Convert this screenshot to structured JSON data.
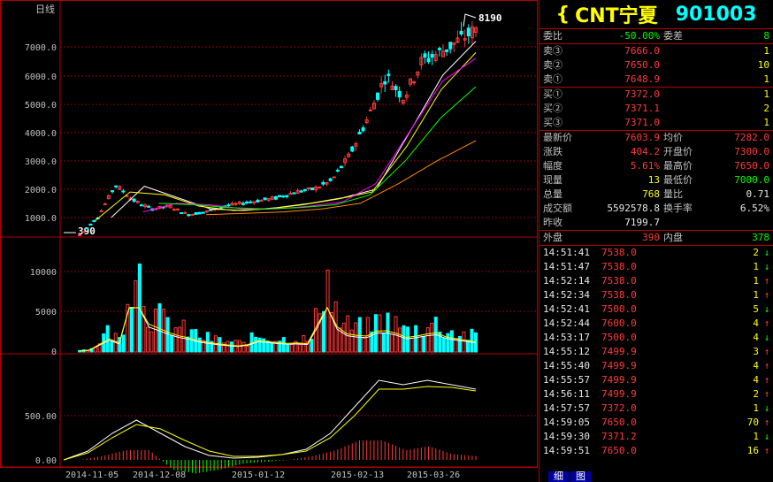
{
  "chart_panel": {
    "period_label": "日线",
    "price_axis_ticks": [
      "7000.0",
      "6000.0",
      "5000.0",
      "4000.0",
      "3000.0",
      "2000.0",
      "1000.0"
    ],
    "volume_axis_ticks": [
      "10000",
      "5000",
      "0"
    ],
    "macd_axis_ticks": [
      "500.00",
      "0.00"
    ],
    "date_labels": [
      "2014-11-05",
      "2014-12-08",
      "2015-01-12",
      "2015-02-13",
      "2015-03-26"
    ],
    "low_marker": "390",
    "high_marker": "8190"
  },
  "chart_data": [
    {
      "type": "candlestick",
      "title": "日线",
      "x": [
        "2014-11-05",
        "2014-12-08",
        "2015-01-12",
        "2015-02-13",
        "2015-03-26"
      ],
      "close_trend": [
        390,
        1000,
        2150,
        1600,
        1300,
        1400,
        1100,
        1200,
        1400,
        1500,
        1600,
        1700,
        1900,
        2000,
        2300,
        3200,
        4500,
        6000,
        5200,
        6500,
        6800,
        7200,
        7600
      ],
      "ma_series": [
        {
          "color": "#ffffff",
          "values": [
            1000,
            2100,
            1700,
            1300,
            1250,
            1350,
            1500,
            1700,
            2000,
            4000,
            6000,
            7200
          ]
        },
        {
          "color": "#ffff00",
          "values": [
            900,
            1900,
            1800,
            1400,
            1250,
            1300,
            1450,
            1650,
            1900,
            3500,
            5500,
            6800
          ]
        },
        {
          "color": "#ff00ff",
          "values": [
            1200,
            1500,
            1450,
            1300,
            1300,
            1400,
            1550,
            2200,
            4000,
            5800,
            6600
          ]
        },
        {
          "color": "#00ff00",
          "values": [
            1500,
            1450,
            1350,
            1300,
            1350,
            1450,
            1800,
            3000,
            4500,
            5600
          ]
        },
        {
          "color": "#ff8c00",
          "values": [
            1100,
            1150,
            1200,
            1300,
            1500,
            2200,
            3000,
            3700
          ]
        }
      ],
      "ylim": [
        390,
        8190
      ]
    },
    {
      "type": "bar",
      "title": "",
      "ylim": [
        0,
        13000
      ],
      "values": [
        200,
        400,
        2500,
        1500,
        13000,
        5000,
        4000,
        3000,
        2500,
        1800,
        1500,
        1200,
        1000,
        2000,
        1800,
        1500,
        1600,
        1400,
        10000,
        3500,
        3000,
        2800,
        4000,
        3500,
        2500,
        3000,
        3500,
        2500,
        2200,
        1800
      ]
    },
    {
      "type": "line",
      "title": "MACD",
      "ylim": [
        -50,
        900
      ],
      "series": [
        {
          "color": "#ffffff",
          "values": [
            0,
            100,
            300,
            450,
            300,
            150,
            50,
            20,
            30,
            60,
            120,
            300,
            600,
            900,
            850,
            900,
            850,
            800
          ]
        },
        {
          "color": "#ffff00",
          "values": [
            0,
            80,
            250,
            400,
            350,
            220,
            100,
            40,
            40,
            60,
            100,
            250,
            500,
            800,
            800,
            830,
            820,
            780
          ]
        }
      ]
    }
  ],
  "quote": {
    "name": "CNT宁夏",
    "code": "901003",
    "weibi_label": "委比",
    "weibi_value": "-50.00%",
    "weicha_label": "委差",
    "weicha_value": "8",
    "sell": [
      {
        "label": "卖③",
        "price": "7666.0",
        "vol": "1"
      },
      {
        "label": "卖②",
        "price": "7650.0",
        "vol": "10"
      },
      {
        "label": "卖①",
        "price": "7648.9",
        "vol": "1"
      }
    ],
    "buy": [
      {
        "label": "买①",
        "price": "7372.0",
        "vol": "1"
      },
      {
        "label": "买②",
        "price": "7371.1",
        "vol": "2"
      },
      {
        "label": "买③",
        "price": "7371.0",
        "vol": "1"
      }
    ],
    "stats": [
      {
        "l1": "最新价",
        "v1": "7603.9",
        "l2": "均价",
        "v2": "7282.0"
      },
      {
        "l1": "涨跌",
        "v1": "404.2",
        "l2": "开盘价",
        "v2": "7300.0"
      },
      {
        "l1": "幅度",
        "v1": "5.61%",
        "l2": "最高价",
        "v2": "7650.0"
      },
      {
        "l1": "现量",
        "v1": "13",
        "l2": "最低价",
        "v2": "7000.0"
      },
      {
        "l1": "总量",
        "v1": "768",
        "l2": "量比",
        "v2": "0.71"
      },
      {
        "l1": "成交额",
        "v1": "5592578.8",
        "l2": "换手率",
        "v2": "6.52%"
      }
    ],
    "zuoshou_label": "昨收",
    "zuoshou_value": "7199.7",
    "waipan_label": "外盘",
    "waipan_value": "390",
    "neipan_label": "内盘",
    "neipan_value": "378",
    "ticks": [
      {
        "time": "14:51:41",
        "price": "7538.0",
        "vol": "2",
        "dir": "down"
      },
      {
        "time": "14:51:47",
        "price": "7538.0",
        "vol": "1",
        "dir": "down"
      },
      {
        "time": "14:52:14",
        "price": "7538.0",
        "vol": "1",
        "dir": "up"
      },
      {
        "time": "14:52:34",
        "price": "7538.0",
        "vol": "1",
        "dir": "up"
      },
      {
        "time": "14:52:41",
        "price": "7500.0",
        "vol": "5",
        "dir": "down"
      },
      {
        "time": "14:52:44",
        "price": "7600.0",
        "vol": "4",
        "dir": "up"
      },
      {
        "time": "14:53:17",
        "price": "7500.0",
        "vol": "4",
        "dir": "down"
      },
      {
        "time": "14:55:12",
        "price": "7499.9",
        "vol": "3",
        "dir": "up"
      },
      {
        "time": "14:55:40",
        "price": "7499.9",
        "vol": "4",
        "dir": "up"
      },
      {
        "time": "14:55:57",
        "price": "7499.9",
        "vol": "4",
        "dir": "up"
      },
      {
        "time": "14:56:11",
        "price": "7499.9",
        "vol": "2",
        "dir": "up"
      },
      {
        "time": "14:57:57",
        "price": "7372.0",
        "vol": "1",
        "dir": "down"
      },
      {
        "time": "14:59:05",
        "price": "7650.0",
        "vol": "70",
        "dir": "up"
      },
      {
        "time": "14:59:30",
        "price": "7371.2",
        "vol": "1",
        "dir": "down"
      },
      {
        "time": "14:59:51",
        "price": "7650.0",
        "vol": "16",
        "dir": "up"
      }
    ],
    "tabs": [
      "细",
      "图"
    ]
  }
}
